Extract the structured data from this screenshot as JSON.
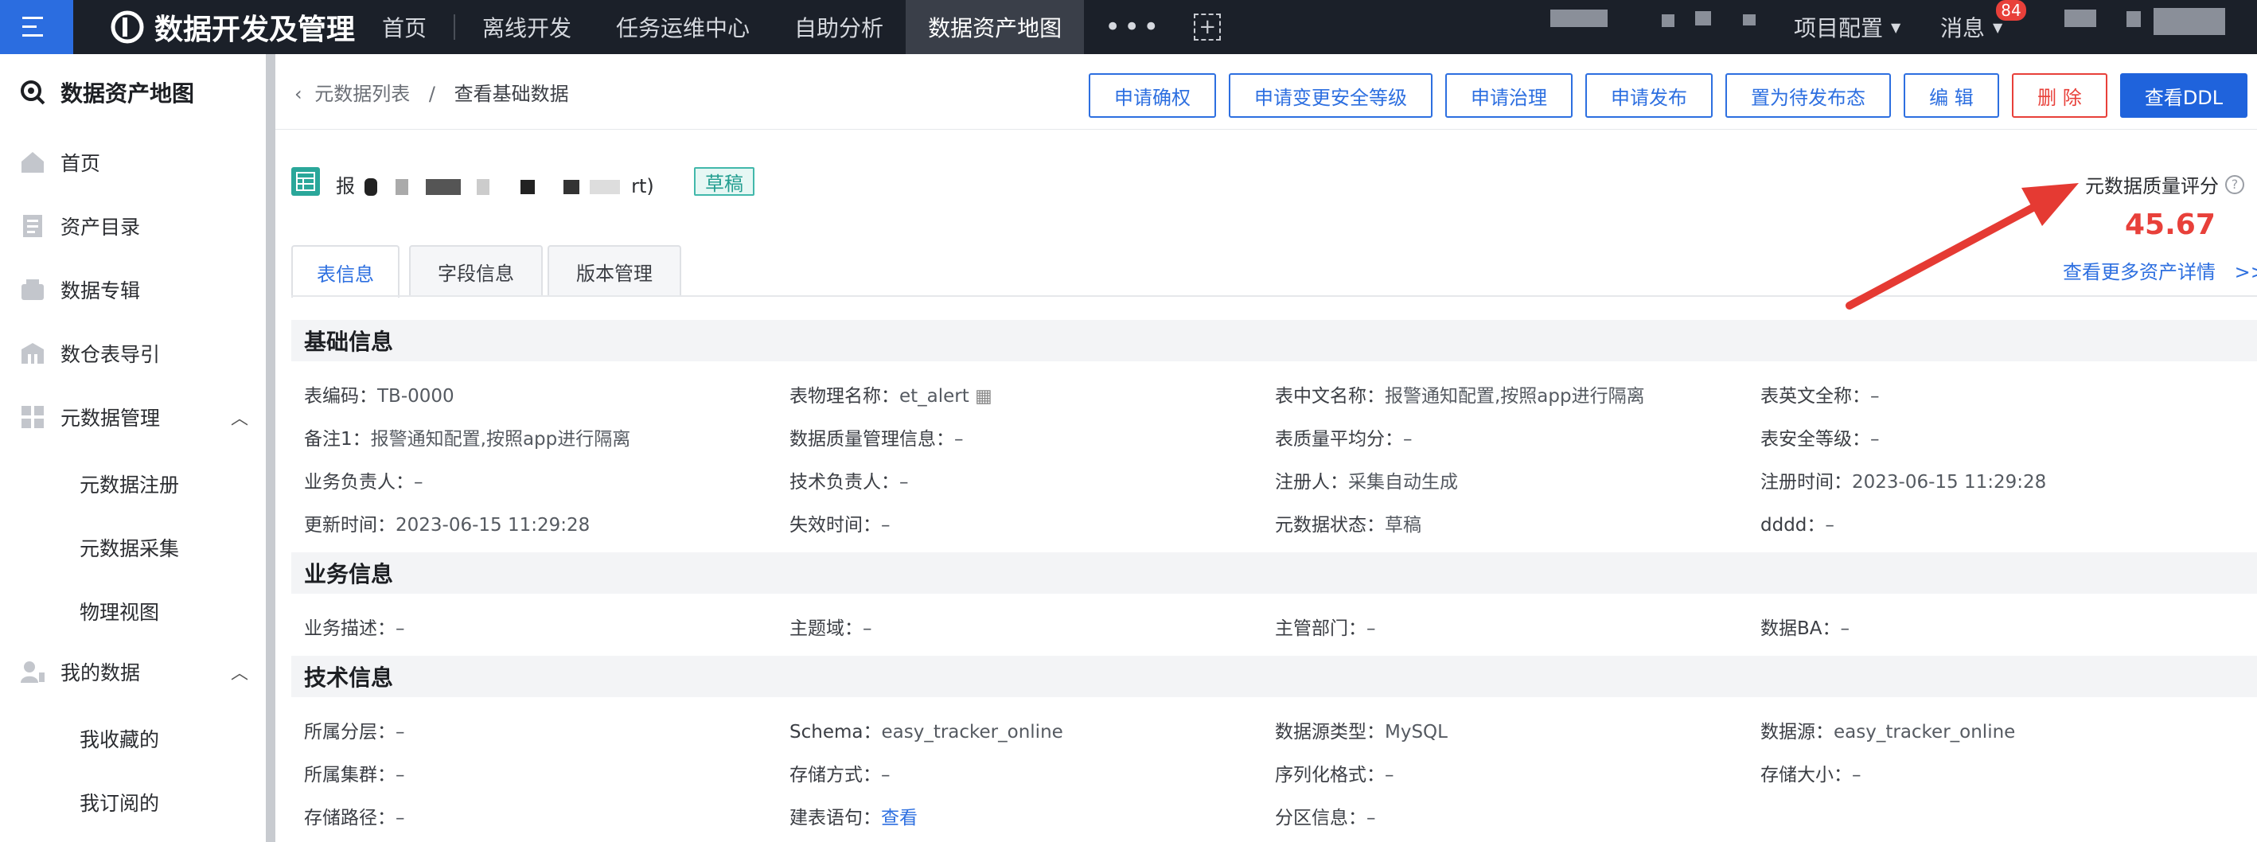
{
  "topbar": {
    "app_title": "数据开发及管理",
    "nav": [
      "首页",
      "离线开发",
      "任务运维中心",
      "自助分析",
      "数据资产地图"
    ],
    "active_nav": "数据资产地图",
    "more": "•••",
    "add": "+",
    "project_config": "项目配置",
    "messages": "消息",
    "message_badge": "84",
    "accent": "#2b6de0"
  },
  "sidebar": {
    "title": "数据资产地图",
    "items": [
      {
        "label": "首页",
        "icon": "home-icon"
      },
      {
        "label": "资产目录",
        "icon": "catalog-icon"
      },
      {
        "label": "数据专辑",
        "icon": "album-icon"
      },
      {
        "label": "数仓表导引",
        "icon": "warehouse-icon"
      },
      {
        "label": "元数据管理",
        "icon": "grid-icon",
        "expanded": true
      },
      {
        "label": "我的数据",
        "icon": "user-icon",
        "expanded": true
      }
    ],
    "metadata_sub": [
      "元数据注册",
      "元数据采集",
      "物理视图"
    ],
    "mydata_sub": [
      "我收藏的",
      "我订阅的"
    ]
  },
  "breadcrumb": {
    "parent": "元数据列表",
    "sep": "/",
    "current": "查看基础数据"
  },
  "actions": [
    "申请确权",
    "申请变更安全等级",
    "申请治理",
    "申请发布",
    "置为待发布态",
    "编 辑",
    "删 除",
    "查看DDL"
  ],
  "table": {
    "name_prefix": "报",
    "name_suffix": "rt)",
    "status_tag": "草稿"
  },
  "quality": {
    "label": "元数据质量评分",
    "help": "?",
    "score": "45.67",
    "more_link": "查看更多资产详情",
    "more_arrow": ">>"
  },
  "tabs": [
    "表信息",
    "字段信息",
    "版本管理"
  ],
  "sections": {
    "basic": {
      "title": "基础信息",
      "fields": [
        {
          "k": "表编码：",
          "v": "TB-0000"
        },
        {
          "k": "表物理名称：",
          "v": "et_alert"
        },
        {
          "k": "表中文名称：",
          "v": "报警通知配置,按照app进行隔离"
        },
        {
          "k": "表英文全称：",
          "v": "–"
        },
        {
          "k": "备注1：",
          "v": "报警通知配置,按照app进行隔离"
        },
        {
          "k": "数据质量管理信息：",
          "v": "–"
        },
        {
          "k": "表质量平均分：",
          "v": "–"
        },
        {
          "k": "表安全等级：",
          "v": "–"
        },
        {
          "k": "业务负责人：",
          "v": "–"
        },
        {
          "k": "技术负责人：",
          "v": "–"
        },
        {
          "k": "注册人：",
          "v": "采集自动生成"
        },
        {
          "k": "注册时间：",
          "v": "2023-06-15 11:29:28"
        },
        {
          "k": "更新时间：",
          "v": "2023-06-15 11:29:28"
        },
        {
          "k": "失效时间：",
          "v": "–"
        },
        {
          "k": "元数据状态：",
          "v": "草稿"
        },
        {
          "k": "dddd：",
          "v": "–"
        }
      ]
    },
    "business": {
      "title": "业务信息",
      "fields": [
        {
          "k": "业务描述：",
          "v": "–"
        },
        {
          "k": "主题域：",
          "v": "–"
        },
        {
          "k": "主管部门：",
          "v": "–"
        },
        {
          "k": "数据BA：",
          "v": "–"
        }
      ]
    },
    "tech": {
      "title": "技术信息",
      "fields": [
        {
          "k": "所属分层：",
          "v": "–"
        },
        {
          "k": "Schema：",
          "v": "easy_tracker_online"
        },
        {
          "k": "数据源类型：",
          "v": "MySQL"
        },
        {
          "k": "数据源：",
          "v": "easy_tracker_online"
        },
        {
          "k": "所属集群：",
          "v": "–"
        },
        {
          "k": "存储方式：",
          "v": "–"
        },
        {
          "k": "序列化格式：",
          "v": "–"
        },
        {
          "k": "存储大小：",
          "v": "–"
        },
        {
          "k": "存储路径：",
          "v": "–"
        },
        {
          "k": "建表语句：",
          "v": "查看"
        },
        {
          "k": "分区信息：",
          "v": "–"
        }
      ]
    }
  }
}
